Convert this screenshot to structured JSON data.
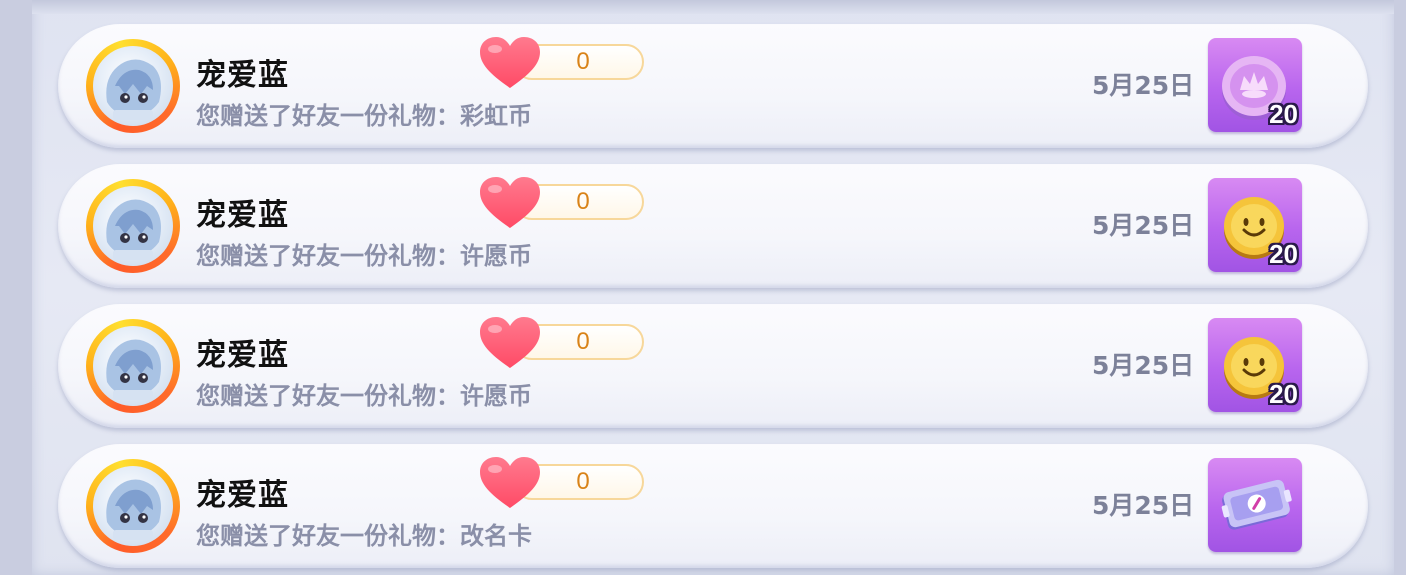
{
  "records": [
    {
      "username": "宠爱蓝",
      "description": "您赠送了好友一份礼物：彩虹币",
      "likes": "0",
      "date": "5月25日",
      "gift_icon": "rainbow-coin-icon",
      "gift_qty": "20"
    },
    {
      "username": "宠爱蓝",
      "description": "您赠送了好友一份礼物：许愿币",
      "likes": "0",
      "date": "5月25日",
      "gift_icon": "wish-coin-icon",
      "gift_qty": "20"
    },
    {
      "username": "宠爱蓝",
      "description": "您赠送了好友一份礼物：许愿币",
      "likes": "0",
      "date": "5月25日",
      "gift_icon": "wish-coin-icon",
      "gift_qty": "20"
    },
    {
      "username": "宠爱蓝",
      "description": "您赠送了好友一份礼物：改名卡",
      "likes": "0",
      "date": "5月25日",
      "gift_icon": "rename-card-icon",
      "gift_qty": ""
    }
  ],
  "colors": {
    "heart": "#ff5c78",
    "like_count": "#d98318",
    "gift_tile": "#b865ee",
    "date_text": "#7c8199",
    "desc_text": "#8a8fa8"
  }
}
